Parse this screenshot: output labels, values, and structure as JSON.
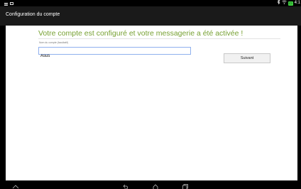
{
  "header": {
    "title": "Configuration du compte"
  },
  "main": {
    "heading": "Votre compte est configuré et votre messagerie a été activée !",
    "account_name_label": "Nom du compte (facultatif)",
    "account_name_value": "Asus",
    "next_button": "Suivant"
  },
  "status_bar": {
    "time": "4:1",
    "battery": "▭"
  },
  "icons": {
    "status_left": [
      "menu-icon",
      "window-icon"
    ],
    "status_right": [
      "bluetooth-icon",
      "wifi-icon",
      "battery-icon"
    ],
    "nav": [
      "home-icon",
      "back-icon",
      "home-icon",
      "recent-apps-icon"
    ]
  },
  "colors": {
    "accent": "#77a133",
    "actionbar": "#1a1a1a",
    "field_border": "#8fb0ee"
  }
}
